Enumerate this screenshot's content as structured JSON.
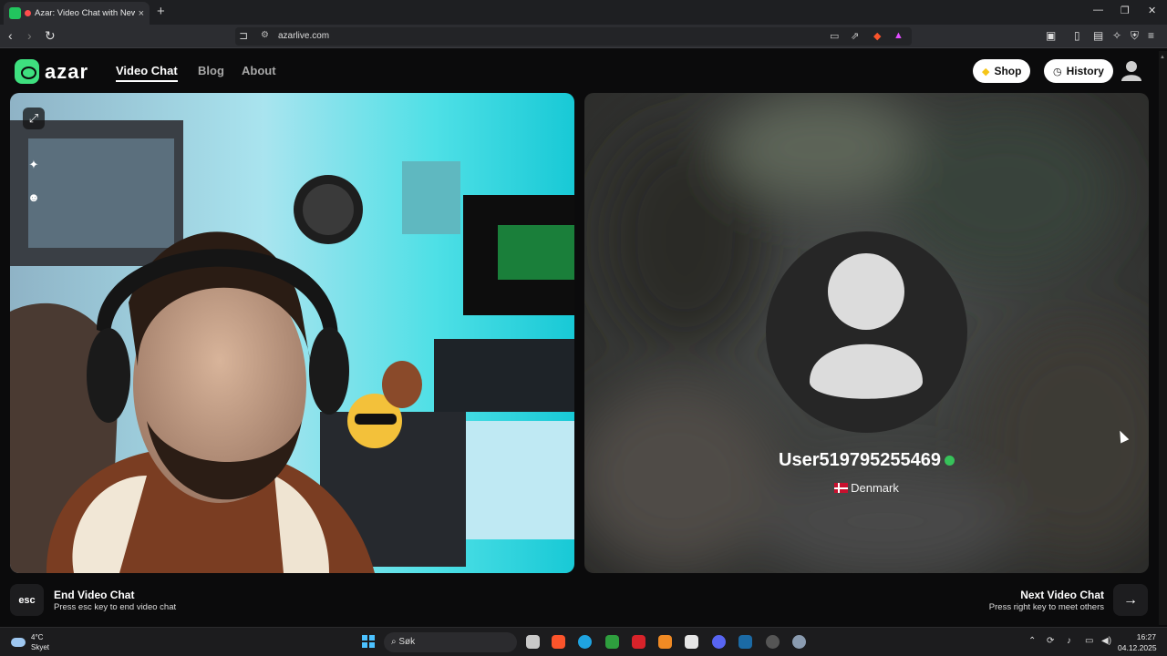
{
  "browser": {
    "tab_title": "Azar: Video Chat with New Pe",
    "tab_close": "×",
    "new_tab": "+",
    "url": "azarlive.com",
    "nav_back": "‹",
    "nav_forward": "›",
    "nav_reload": "↻",
    "window_min": "—",
    "window_max": "❐",
    "window_close": "✕"
  },
  "site": {
    "logo_text": "azar",
    "nav": [
      "Video Chat",
      "Blog",
      "About"
    ],
    "shop_label": "Shop",
    "history_label": "History"
  },
  "remote": {
    "username": "User519795255469",
    "country": "Denmark"
  },
  "controls": {
    "esc_key": "esc",
    "end_title": "End Video Chat",
    "end_sub": "Press esc key to end video chat",
    "next_title": "Next Video Chat",
    "next_sub": "Press right key to meet others",
    "next_arrow": "→"
  },
  "taskbar": {
    "temperature": "4°C",
    "weather": "Skyet",
    "search_placeholder": "Søk",
    "time": "16:27",
    "date": "04.12.2025"
  },
  "colors": {
    "brand": "#3ee07f",
    "background": "#0b0b0c",
    "verified": "#37c25a"
  }
}
